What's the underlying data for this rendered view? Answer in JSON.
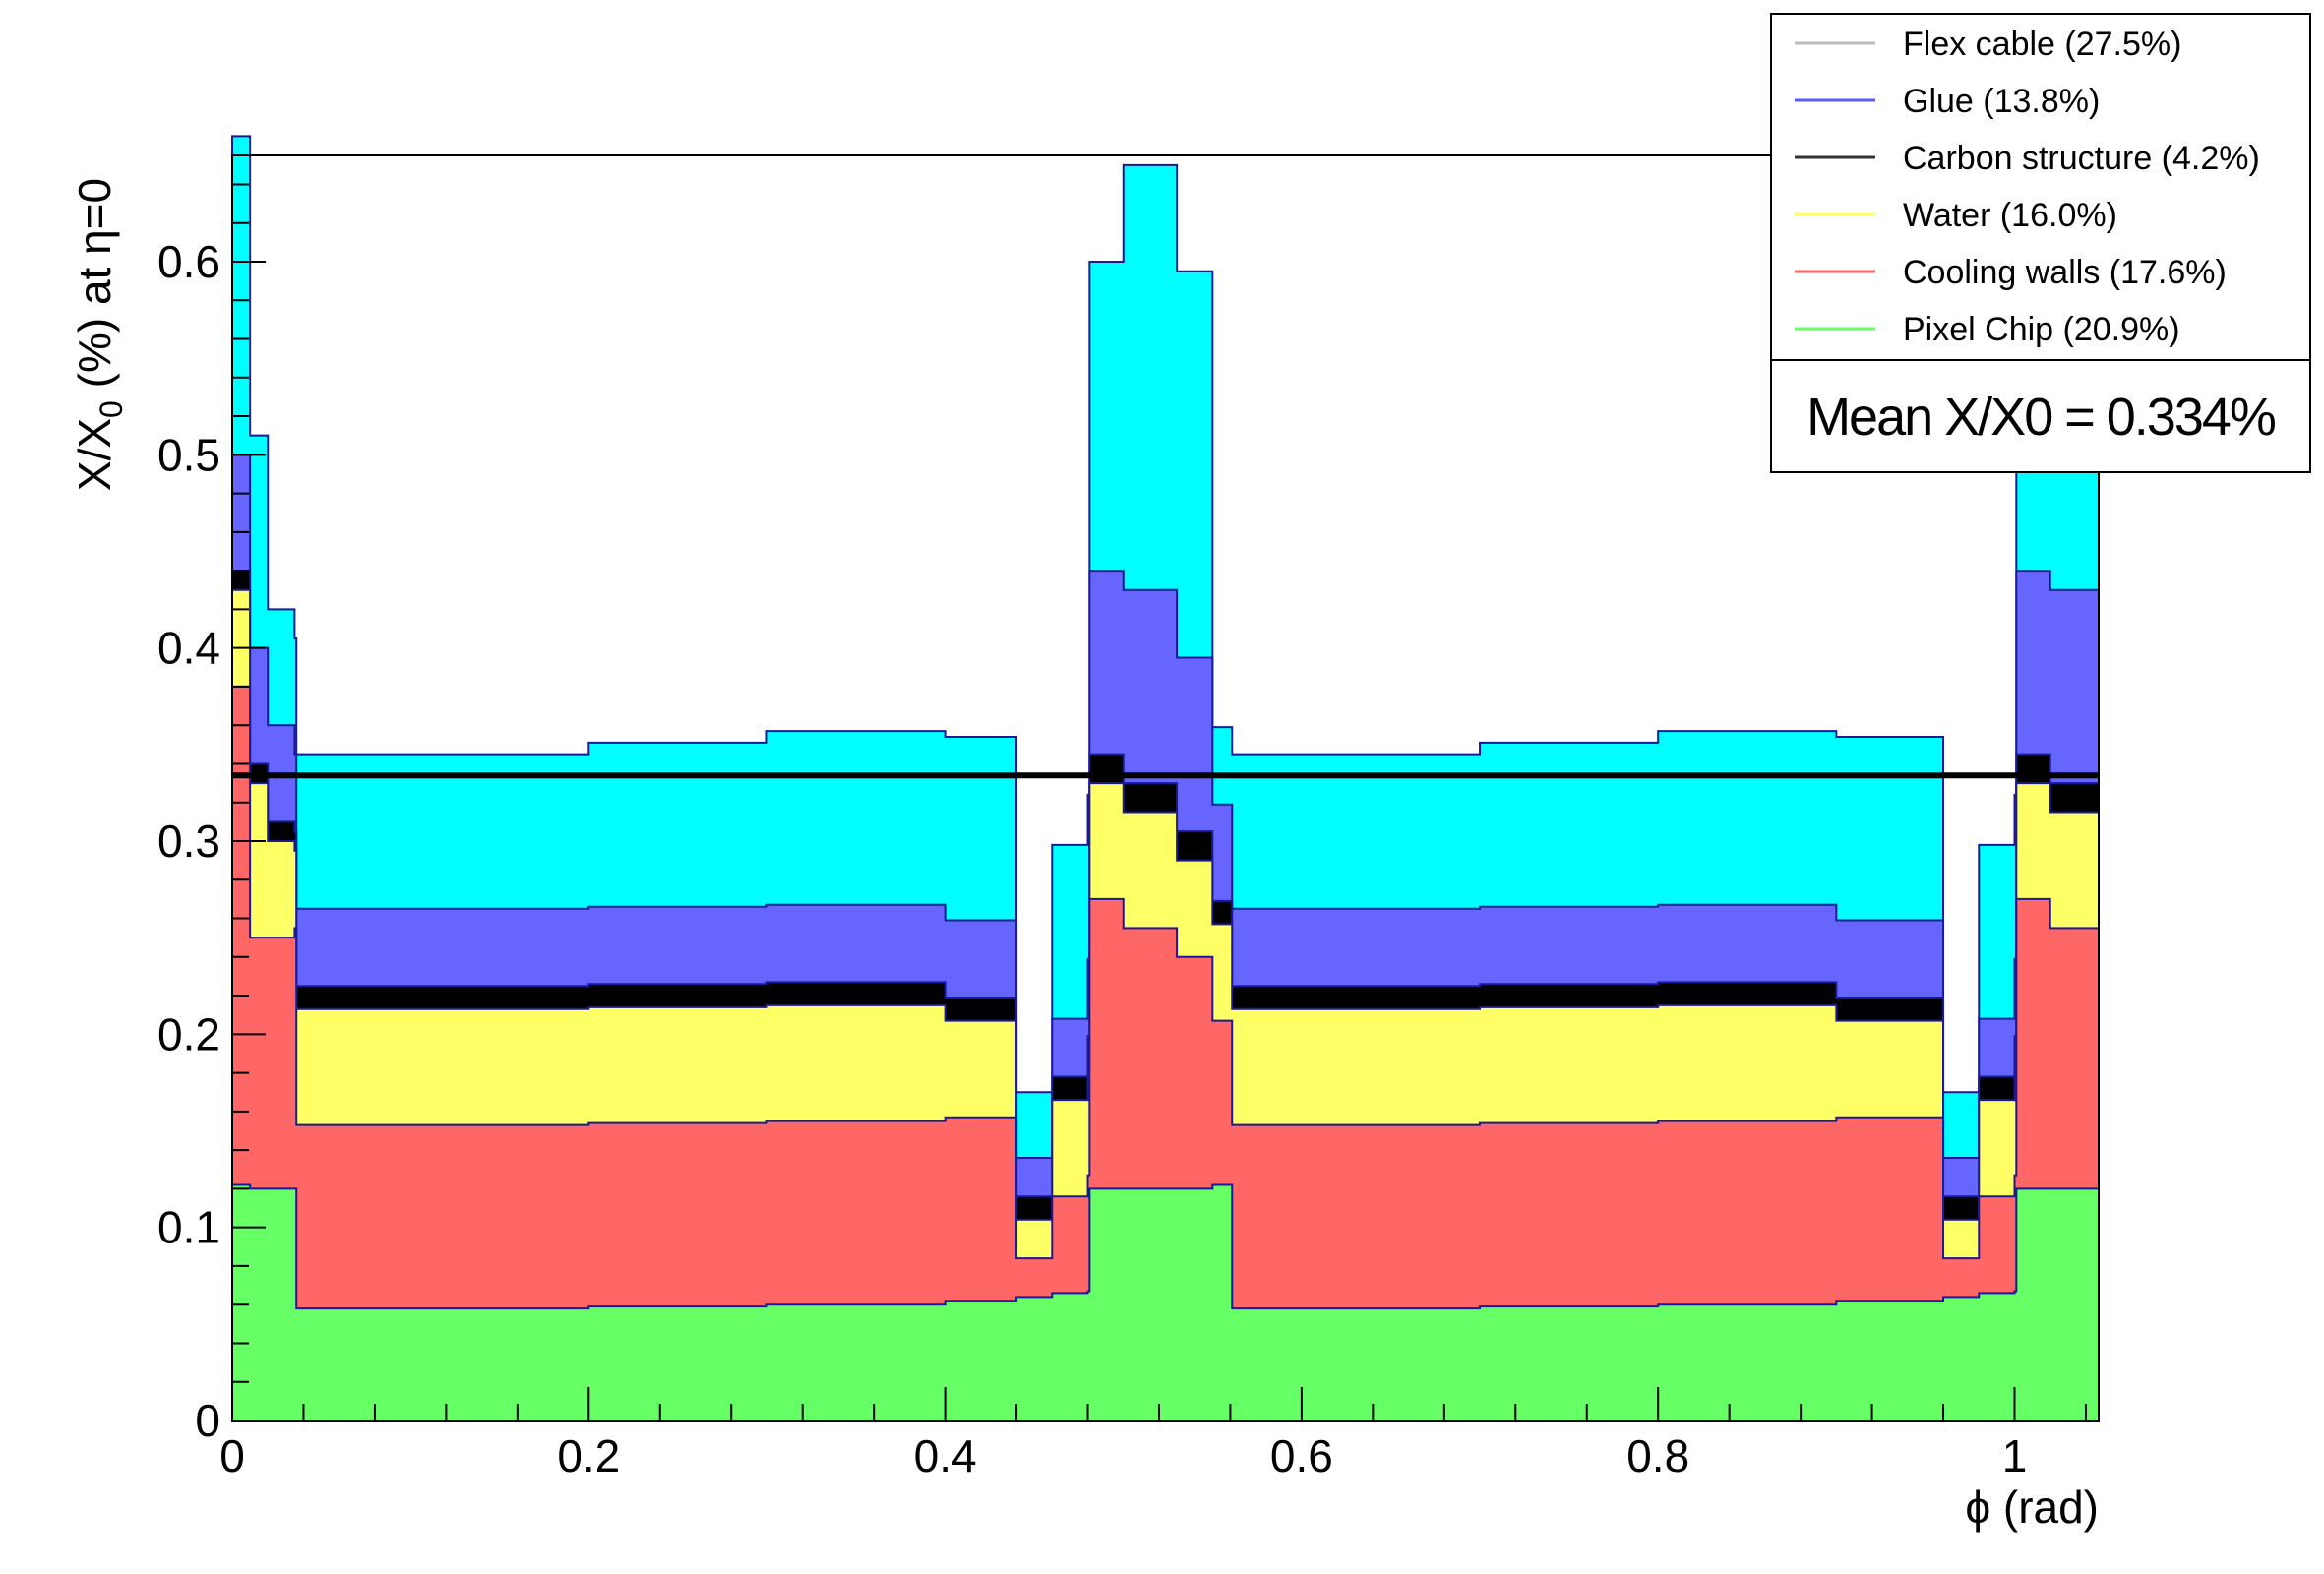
{
  "chart_data": {
    "type": "area",
    "xlabel": "ϕ (rad)",
    "ylabel_main": "X/X",
    "ylabel_sub": "0",
    "ylabel_tail": " (%) at η=0",
    "xlim": [
      0,
      1.0472
    ],
    "ylim": [
      0,
      0.655
    ],
    "x_ticks": [
      0,
      0.2,
      0.4,
      0.6,
      0.8,
      1
    ],
    "x_tick_labels": [
      "0",
      "0.2",
      "0.4",
      "0.6",
      "0.8",
      "1"
    ],
    "y_ticks": [
      0,
      0.1,
      0.2,
      0.3,
      0.4,
      0.5,
      0.6
    ],
    "y_tick_labels": [
      "0",
      "0.1",
      "0.2",
      "0.3",
      "0.4",
      "0.5",
      "0.6"
    ],
    "mean_line": 0.334,
    "mean_label": "Mean X/X0 =  0.334%",
    "legend_position": "top-right",
    "legend": [
      {
        "label": "Flex cable (27.5%)",
        "color": "#bbbbbb"
      },
      {
        "label": "Glue (13.8%)",
        "color": "#5a5aff"
      },
      {
        "label": "Carbon structure (4.2%)",
        "color": "#333333"
      },
      {
        "label": "Water (16.0%)",
        "color": "#ffff66"
      },
      {
        "label": "Cooling walls (17.6%)",
        "color": "#ff6666"
      },
      {
        "label": "Pixel Chip (20.9%)",
        "color": "#66ff66"
      }
    ],
    "stack_fill_colors": {
      "pixel_chip": "#66ff66",
      "cooling_walls": "#ff6666",
      "water": "#ffff66",
      "carbon": "#000000",
      "glue": "#6666ff",
      "flex": "#00ffff",
      "outline": "#1a1a99"
    },
    "profile_x": [
      0,
      0.01,
      0.02,
      0.035,
      0.036,
      0.1,
      0.2,
      0.3,
      0.4,
      0.44,
      0.46,
      0.48,
      0.481,
      0.5,
      0.53,
      0.55,
      0.56,
      0.561,
      0.6,
      0.7,
      0.8,
      0.9,
      0.96,
      0.98,
      1.0,
      1.001,
      1.02,
      1.0472
    ],
    "series": [
      {
        "name": "Pixel Chip (20.9%)",
        "values": [
          0.122,
          0.12,
          0.12,
          0.12,
          0.058,
          0.058,
          0.059,
          0.06,
          0.062,
          0.064,
          0.066,
          0.067,
          0.12,
          0.12,
          0.12,
          0.122,
          0.122,
          0.058,
          0.058,
          0.059,
          0.06,
          0.062,
          0.064,
          0.066,
          0.067,
          0.12,
          0.12,
          0.122
        ]
      },
      {
        "name": "Cooling walls (17.6%)",
        "values": [
          0.258,
          0.13,
          0.13,
          0.135,
          0.095,
          0.095,
          0.095,
          0.095,
          0.095,
          0.02,
          0.05,
          0.06,
          0.15,
          0.135,
          0.12,
          0.085,
          0.085,
          0.095,
          0.095,
          0.095,
          0.095,
          0.095,
          0.02,
          0.05,
          0.06,
          0.15,
          0.135,
          0.088
        ]
      },
      {
        "name": "Water (16.0%)",
        "values": [
          0.05,
          0.08,
          0.05,
          0.04,
          0.06,
          0.06,
          0.06,
          0.06,
          0.05,
          0.02,
          0.05,
          0.06,
          0.06,
          0.06,
          0.05,
          0.05,
          0.05,
          0.06,
          0.06,
          0.06,
          0.06,
          0.05,
          0.02,
          0.05,
          0.06,
          0.06,
          0.06,
          0.1
        ]
      },
      {
        "name": "Carbon structure (4.2%)",
        "values": [
          0.01,
          0.01,
          0.01,
          0.01,
          0.012,
          0.012,
          0.012,
          0.012,
          0.012,
          0.012,
          0.012,
          0.012,
          0.015,
          0.015,
          0.015,
          0.012,
          0.012,
          0.012,
          0.012,
          0.012,
          0.012,
          0.012,
          0.012,
          0.012,
          0.012,
          0.015,
          0.015,
          0.012
        ]
      },
      {
        "name": "Glue (13.8%)",
        "values": [
          0.06,
          0.06,
          0.05,
          0.04,
          0.04,
          0.04,
          0.04,
          0.04,
          0.04,
          0.02,
          0.03,
          0.04,
          0.095,
          0.1,
          0.09,
          0.05,
          0.05,
          0.04,
          0.04,
          0.04,
          0.04,
          0.04,
          0.02,
          0.03,
          0.04,
          0.095,
          0.1,
          0.08
        ]
      },
      {
        "name": "Flex cable (27.5%)",
        "values": [
          0.165,
          0.11,
          0.06,
          0.06,
          0.08,
          0.08,
          0.085,
          0.09,
          0.095,
          0.034,
          0.09,
          0.085,
          0.16,
          0.22,
          0.2,
          0.04,
          0.04,
          0.08,
          0.08,
          0.085,
          0.09,
          0.095,
          0.034,
          0.09,
          0.085,
          0.16,
          0.22,
          0.2
        ]
      }
    ]
  }
}
